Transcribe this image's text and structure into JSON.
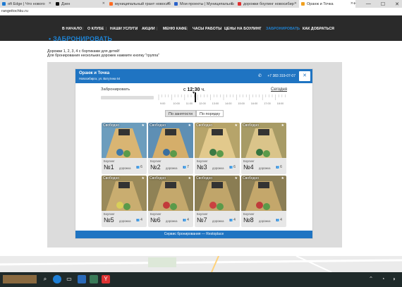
{
  "browser": {
    "tabs": [
      {
        "label": "oft Edge | Что нового",
        "fav": "#1f7ad1"
      },
      {
        "label": "Дзен",
        "fav": "#111111"
      },
      {
        "label": "муниципальный грант новосиб",
        "fav": "#ff6b21"
      },
      {
        "label": "Мои проекты | Муниципальны",
        "fav": "#2a62c9"
      },
      {
        "label": "дорожки боулинг новосибир",
        "fav": "#e03030"
      },
      {
        "label": "Оранж и Точка",
        "fav": "#f0a020"
      }
    ],
    "window_controls": [
      "+",
      "—",
      "☐",
      "✕"
    ],
    "address": "rangeitochku.ru"
  },
  "site": {
    "nav": [
      "В НАЧАЛО",
      "О КЛУБЕ",
      "НАШИ УСЛУГИ",
      "АКЦИИ",
      "МЕНЮ КАФЕ",
      "ЧАСЫ РАБОТЫ",
      "ЦЕНЫ НА БОУЛИНГ",
      "ЗАБРОНИРОВАТЬ",
      "КАК ДОБРАТЬСЯ"
    ],
    "active_nav": "ЗАБРОНИРОВАТЬ",
    "heading": "ЗАБРОНИРОВАТЬ",
    "note1": "Дорожки 1, 2, 3, 4 с бортиками для детей!",
    "note2": "Для бронирования нескольких дорожек нажмите кнопку \"группа\""
  },
  "widget": {
    "name": "Оранж и Точка",
    "address": "Новосибирск, ул. Ватутина 64",
    "phone": "+7 383 319-07-07",
    "book_label": "Забронировать",
    "time_prefix": "с",
    "time": "12:30",
    "time_suffix": "ч.",
    "today": "Сегодня",
    "ticks": [
      "9:00",
      "10:00",
      "11:00",
      "12:00",
      "13:00",
      "14:00",
      "15:00",
      "16:00",
      "17:00",
      "18:00"
    ],
    "seg": [
      "По занятости",
      "По порядку"
    ],
    "footer": "Сервис бронирования — Restoplace",
    "lanes": [
      {
        "status": "Свободно",
        "kind": "Боулинг",
        "num": "№1",
        "word": "дорожка",
        "cap": "6"
      },
      {
        "status": "Свободно",
        "kind": "Боулинг",
        "num": "№2",
        "word": "дорожка",
        "cap": "7"
      },
      {
        "status": "Свободно",
        "kind": "Боулинг",
        "num": "№3",
        "word": "дорожка",
        "cap": "6"
      },
      {
        "status": "Свободно",
        "kind": "Боулинг",
        "num": "№4",
        "word": "дорожка",
        "cap": "6"
      },
      {
        "status": "Свободно",
        "kind": "Боулинг",
        "num": "№5",
        "word": "дорожка",
        "cap": "4"
      },
      {
        "status": "Свободно",
        "kind": "Боулинг",
        "num": "№6",
        "word": "дорожка",
        "cap": "4"
      },
      {
        "status": "Свободно",
        "kind": "Боулинг",
        "num": "№7",
        "word": "дорожка",
        "cap": "4"
      },
      {
        "status": "Свободно",
        "kind": "Боулинг",
        "num": "№8",
        "word": "дорожка",
        "cap": "4"
      }
    ]
  },
  "colors": {
    "accent": "#1f74c2",
    "nav_bg": "#2a2a2a"
  }
}
